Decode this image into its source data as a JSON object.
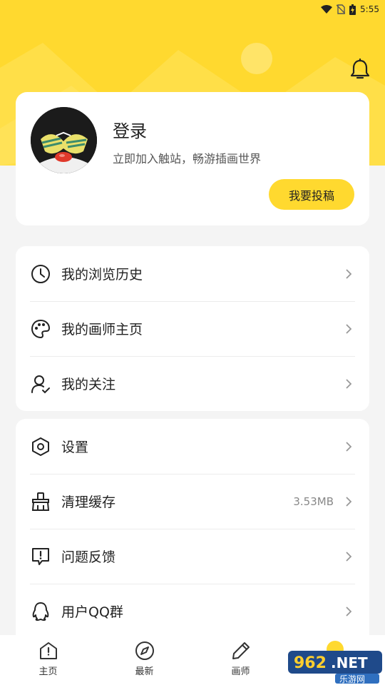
{
  "status_bar": {
    "time": "5:55",
    "icons": [
      "wifi-icon",
      "no-sim-icon",
      "battery-charging-icon"
    ]
  },
  "header": {
    "notification_icon": "bell-icon"
  },
  "profile": {
    "title": "登录",
    "subtitle": "立即加入触站，畅游插画世界",
    "submit_label": "我要投稿"
  },
  "menu_group_1": [
    {
      "icon": "clock-icon",
      "label": "我的浏览历史"
    },
    {
      "icon": "palette-icon",
      "label": "我的画师主页"
    },
    {
      "icon": "user-check-icon",
      "label": "我的关注"
    }
  ],
  "menu_group_2": [
    {
      "icon": "hexagon-settings-icon",
      "label": "设置"
    },
    {
      "icon": "broom-icon",
      "label": "清理缓存",
      "value": "3.53MB"
    },
    {
      "icon": "feedback-icon",
      "label": "问题反馈"
    },
    {
      "icon": "qq-penguin-icon",
      "label": "用户QQ群"
    }
  ],
  "tabbar": [
    {
      "icon": "home-icon",
      "label": "主页"
    },
    {
      "icon": "compass-icon",
      "label": "最新"
    },
    {
      "icon": "pencil-icon",
      "label": "画师"
    }
  ],
  "watermark": {
    "text": "962.NET",
    "sub": "乐游网"
  },
  "colors": {
    "accent": "#ffd92f",
    "background": "#f4f4f4",
    "card": "#ffffff"
  }
}
